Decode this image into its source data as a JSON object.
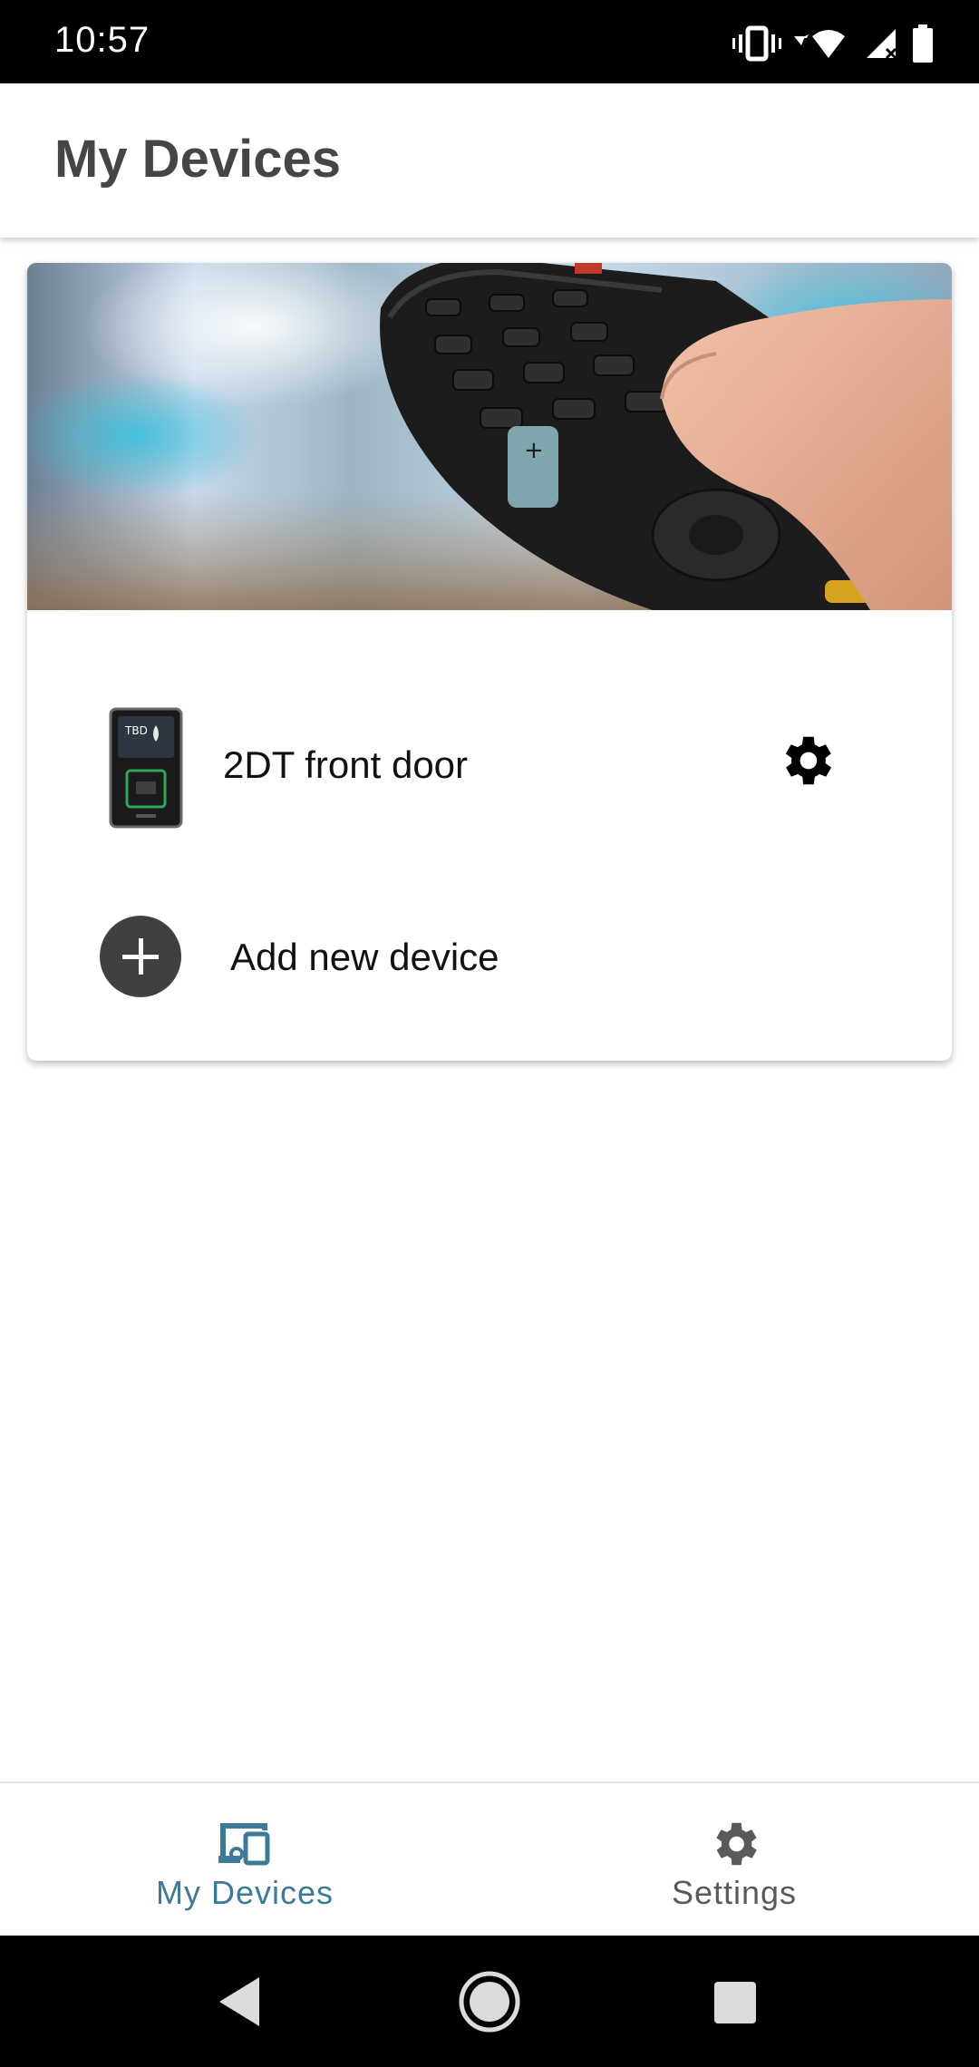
{
  "status_bar": {
    "time": "10:57",
    "icons": [
      "vibrate-icon",
      "wifi-icon",
      "cell-signal-icon",
      "battery-icon"
    ]
  },
  "header": {
    "title": "My Devices"
  },
  "card": {
    "hero_image": "tv-remote-photo",
    "devices": [
      {
        "name": "2DT front door",
        "thumbnail": "door-panel-device",
        "settings_icon": "gear-icon"
      }
    ],
    "add_device_label": "Add new device"
  },
  "bottom_nav": {
    "items": [
      {
        "label": "My Devices",
        "icon": "devices-icon",
        "active": true
      },
      {
        "label": "Settings",
        "icon": "gear-icon",
        "active": false
      }
    ]
  },
  "system_nav": {
    "buttons": [
      "back-icon",
      "home-icon",
      "recents-icon"
    ]
  },
  "colors": {
    "accent": "#3d7a98",
    "inactive": "#5a5a5a",
    "title": "#454545"
  }
}
